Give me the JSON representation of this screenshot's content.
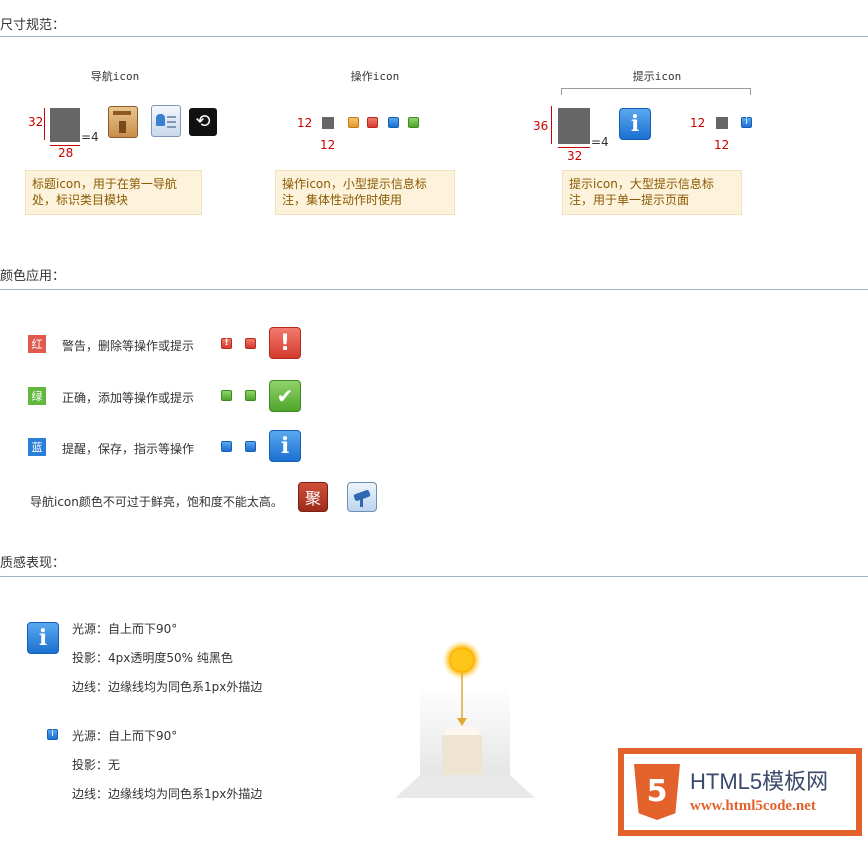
{
  "sections": {
    "size": "尺寸规范：",
    "color": "颜色应用：",
    "texture": "质感表现："
  },
  "size_spec": {
    "columns": [
      {
        "title": "导航icon",
        "height_label": "32",
        "width_label": "28",
        "radius_label": "=4",
        "note": "标题icon，用于在第一导航处，标识类目模块"
      },
      {
        "title": "操作icon",
        "height_label": "12",
        "width_label": "12",
        "note": "操作icon，小型提示信息标注，集体性动作时使用"
      },
      {
        "title": "提示icon",
        "height_label": "36",
        "width_label": "32",
        "radius_label": "=4",
        "small_height_label": "12",
        "small_width_label": "12",
        "note": "提示icon，大型提示信息标注，用于单一提示页面"
      }
    ]
  },
  "color_usage": {
    "rows": [
      {
        "swatch": "红",
        "color": "#e05a4e",
        "text": "警告，删除等操作或提示",
        "big_symbol": "!"
      },
      {
        "swatch": "绿",
        "color": "#62b83e",
        "text": "正确，添加等操作或提示",
        "big_symbol": "✔"
      },
      {
        "swatch": "蓝",
        "color": "#2c7fd9",
        "text": "提醒，保存，指示等操作",
        "big_symbol": "i"
      }
    ],
    "nav_note": "导航icon颜色不可过于鲜亮，饱和度不能太高。",
    "nav_icon_char": "聚"
  },
  "texture": {
    "large": [
      "光源：自上而下90°",
      "投影：4px透明度50% 纯黑色",
      "边线：边缘线均为同色系1px外描边"
    ],
    "small": [
      "光源：自上而下90°",
      "投影：无",
      "边线：边缘线均为同色系1px外描边"
    ]
  },
  "watermark": {
    "title": "HTML5模板网",
    "url": "www.html5code.net",
    "badge": "5"
  }
}
